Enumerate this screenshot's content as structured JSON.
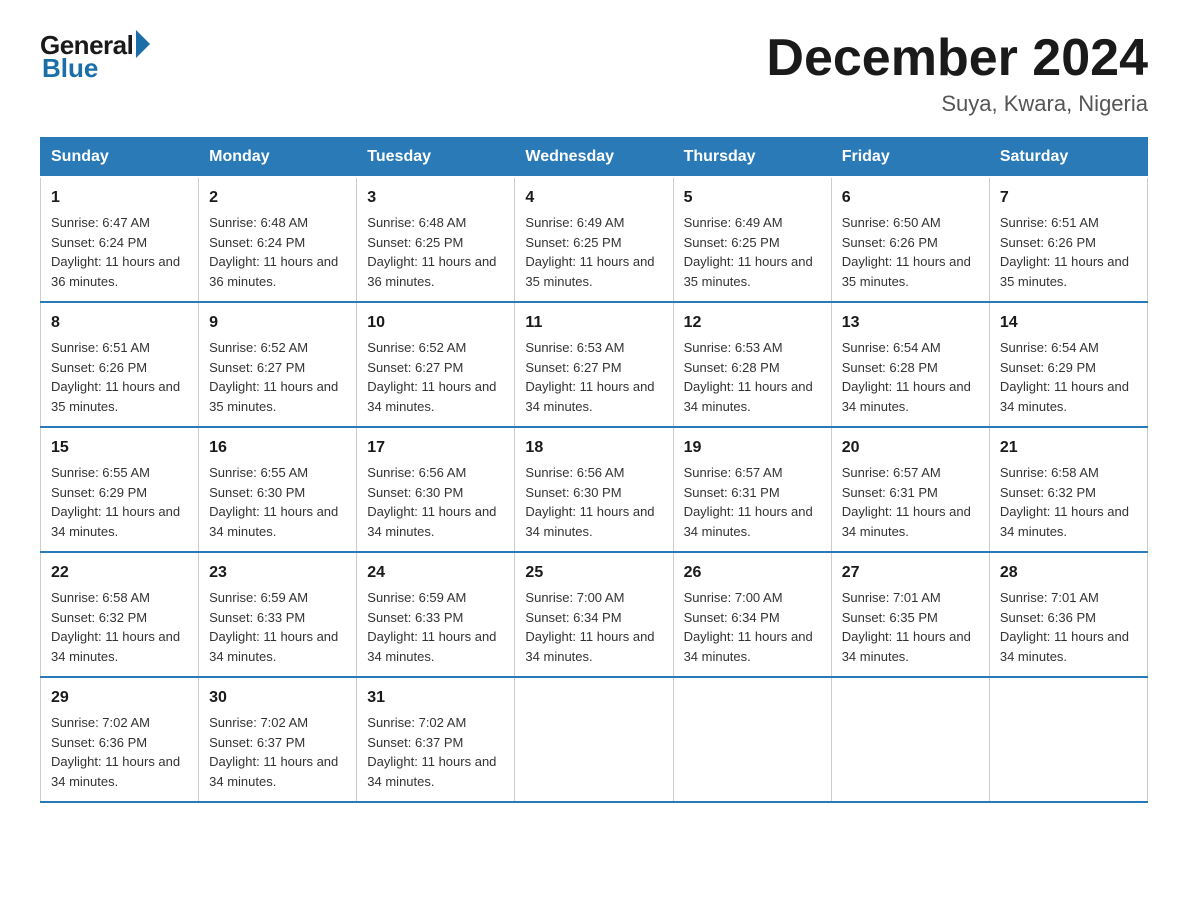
{
  "logo": {
    "general": "General",
    "blue": "Blue"
  },
  "title": "December 2024",
  "location": "Suya, Kwara, Nigeria",
  "days_of_week": [
    "Sunday",
    "Monday",
    "Tuesday",
    "Wednesday",
    "Thursday",
    "Friday",
    "Saturday"
  ],
  "weeks": [
    [
      {
        "day": "1",
        "sunrise": "6:47 AM",
        "sunset": "6:24 PM",
        "daylight": "11 hours and 36 minutes."
      },
      {
        "day": "2",
        "sunrise": "6:48 AM",
        "sunset": "6:24 PM",
        "daylight": "11 hours and 36 minutes."
      },
      {
        "day": "3",
        "sunrise": "6:48 AM",
        "sunset": "6:25 PM",
        "daylight": "11 hours and 36 minutes."
      },
      {
        "day": "4",
        "sunrise": "6:49 AM",
        "sunset": "6:25 PM",
        "daylight": "11 hours and 35 minutes."
      },
      {
        "day": "5",
        "sunrise": "6:49 AM",
        "sunset": "6:25 PM",
        "daylight": "11 hours and 35 minutes."
      },
      {
        "day": "6",
        "sunrise": "6:50 AM",
        "sunset": "6:26 PM",
        "daylight": "11 hours and 35 minutes."
      },
      {
        "day": "7",
        "sunrise": "6:51 AM",
        "sunset": "6:26 PM",
        "daylight": "11 hours and 35 minutes."
      }
    ],
    [
      {
        "day": "8",
        "sunrise": "6:51 AM",
        "sunset": "6:26 PM",
        "daylight": "11 hours and 35 minutes."
      },
      {
        "day": "9",
        "sunrise": "6:52 AM",
        "sunset": "6:27 PM",
        "daylight": "11 hours and 35 minutes."
      },
      {
        "day": "10",
        "sunrise": "6:52 AM",
        "sunset": "6:27 PM",
        "daylight": "11 hours and 34 minutes."
      },
      {
        "day": "11",
        "sunrise": "6:53 AM",
        "sunset": "6:27 PM",
        "daylight": "11 hours and 34 minutes."
      },
      {
        "day": "12",
        "sunrise": "6:53 AM",
        "sunset": "6:28 PM",
        "daylight": "11 hours and 34 minutes."
      },
      {
        "day": "13",
        "sunrise": "6:54 AM",
        "sunset": "6:28 PM",
        "daylight": "11 hours and 34 minutes."
      },
      {
        "day": "14",
        "sunrise": "6:54 AM",
        "sunset": "6:29 PM",
        "daylight": "11 hours and 34 minutes."
      }
    ],
    [
      {
        "day": "15",
        "sunrise": "6:55 AM",
        "sunset": "6:29 PM",
        "daylight": "11 hours and 34 minutes."
      },
      {
        "day": "16",
        "sunrise": "6:55 AM",
        "sunset": "6:30 PM",
        "daylight": "11 hours and 34 minutes."
      },
      {
        "day": "17",
        "sunrise": "6:56 AM",
        "sunset": "6:30 PM",
        "daylight": "11 hours and 34 minutes."
      },
      {
        "day": "18",
        "sunrise": "6:56 AM",
        "sunset": "6:30 PM",
        "daylight": "11 hours and 34 minutes."
      },
      {
        "day": "19",
        "sunrise": "6:57 AM",
        "sunset": "6:31 PM",
        "daylight": "11 hours and 34 minutes."
      },
      {
        "day": "20",
        "sunrise": "6:57 AM",
        "sunset": "6:31 PM",
        "daylight": "11 hours and 34 minutes."
      },
      {
        "day": "21",
        "sunrise": "6:58 AM",
        "sunset": "6:32 PM",
        "daylight": "11 hours and 34 minutes."
      }
    ],
    [
      {
        "day": "22",
        "sunrise": "6:58 AM",
        "sunset": "6:32 PM",
        "daylight": "11 hours and 34 minutes."
      },
      {
        "day": "23",
        "sunrise": "6:59 AM",
        "sunset": "6:33 PM",
        "daylight": "11 hours and 34 minutes."
      },
      {
        "day": "24",
        "sunrise": "6:59 AM",
        "sunset": "6:33 PM",
        "daylight": "11 hours and 34 minutes."
      },
      {
        "day": "25",
        "sunrise": "7:00 AM",
        "sunset": "6:34 PM",
        "daylight": "11 hours and 34 minutes."
      },
      {
        "day": "26",
        "sunrise": "7:00 AM",
        "sunset": "6:34 PM",
        "daylight": "11 hours and 34 minutes."
      },
      {
        "day": "27",
        "sunrise": "7:01 AM",
        "sunset": "6:35 PM",
        "daylight": "11 hours and 34 minutes."
      },
      {
        "day": "28",
        "sunrise": "7:01 AM",
        "sunset": "6:36 PM",
        "daylight": "11 hours and 34 minutes."
      }
    ],
    [
      {
        "day": "29",
        "sunrise": "7:02 AM",
        "sunset": "6:36 PM",
        "daylight": "11 hours and 34 minutes."
      },
      {
        "day": "30",
        "sunrise": "7:02 AM",
        "sunset": "6:37 PM",
        "daylight": "11 hours and 34 minutes."
      },
      {
        "day": "31",
        "sunrise": "7:02 AM",
        "sunset": "6:37 PM",
        "daylight": "11 hours and 34 minutes."
      },
      null,
      null,
      null,
      null
    ]
  ]
}
